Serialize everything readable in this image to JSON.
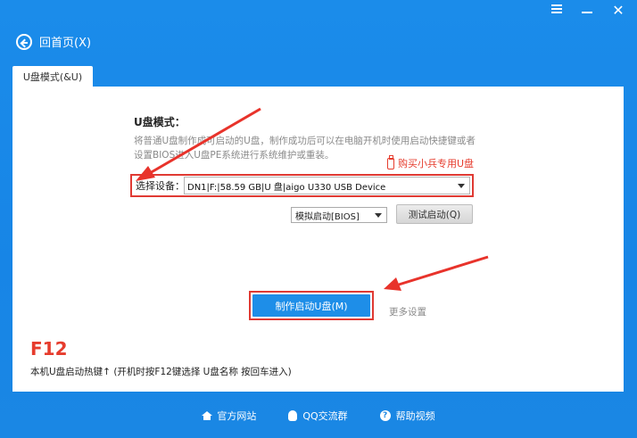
{
  "nav": {
    "back_label": "回首页(X)"
  },
  "tabs": [
    {
      "label": "U盘模式(&U)"
    }
  ],
  "main": {
    "section_title": "U盘模式：",
    "description": "将普通U盘制作成可启动的U盘，制作成功后可以在电脑开机时使用启动快捷键或者设置BIOS进入U盘PE系统进行系统维护或重装。",
    "buy_link": "购买小兵专用U盘",
    "device_label": "选择设备：",
    "device_value": "DN1|F:|58.59 GB|U 盘|aigo U330 USB Device",
    "boot_mode_value": "模拟启动[BIOS]",
    "test_button": "测试启动(Q)",
    "make_button": "制作启动U盘(M)",
    "more_settings": "更多设置",
    "f12_label": "F12",
    "hotkey_text": "本机U盘启动热键↑ (开机时按F12键选择 U盘名称 按回车进入)"
  },
  "footer": {
    "official_site": "官方网站",
    "qq_group": "QQ交流群",
    "help_video": "帮助视频"
  },
  "colors": {
    "header_blue": "#1b8cea",
    "primary_button": "#1e8ee8",
    "highlight_red": "#e03a33"
  }
}
